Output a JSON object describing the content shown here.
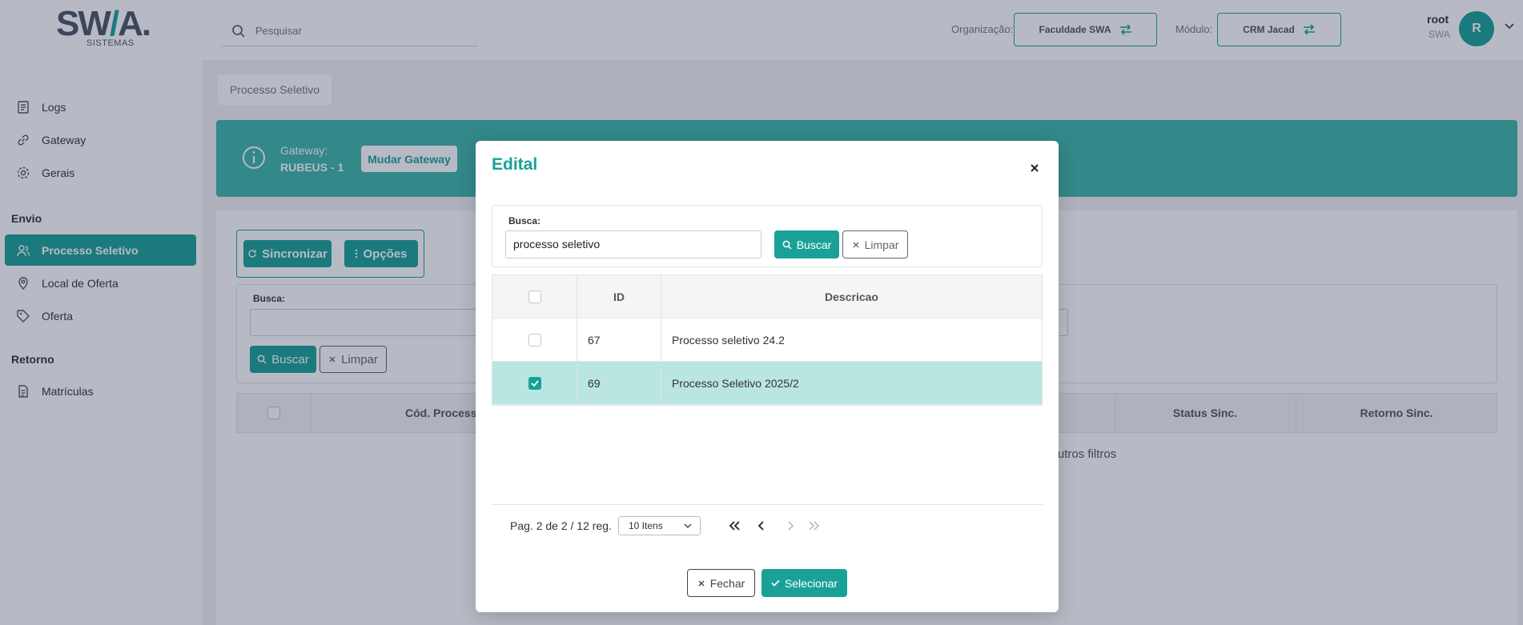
{
  "colors": {
    "accent": "#1aa197",
    "banner": "#3db5a9",
    "selected_row": "#b9e6e1"
  },
  "header": {
    "logo_text": "SWA.",
    "logo_sub": "SISTEMAS",
    "search_placeholder": "Pesquisar",
    "org_label": "Organização:",
    "org_value": "Faculdade SWA",
    "module_label": "Módulo:",
    "module_value": "CRM Jacad",
    "user_name": "root",
    "user_org": "SWA",
    "avatar_initial": "R"
  },
  "sidebar": {
    "items": [
      {
        "label": "Logs",
        "icon": "log-icon"
      },
      {
        "label": "Gateway",
        "icon": "link-icon"
      },
      {
        "label": "Gerais",
        "icon": "gear-icon"
      }
    ],
    "section_envio": "Envio",
    "envio_items": [
      {
        "label": "Processo Seletivo",
        "icon": "users-icon",
        "active": true
      },
      {
        "label": "Local de Oferta",
        "icon": "location-pin-icon"
      },
      {
        "label": "Oferta",
        "icon": "tag-icon"
      }
    ],
    "section_retorno": "Retorno",
    "retorno_items": [
      {
        "label": "Matrículas",
        "icon": "document-icon"
      }
    ]
  },
  "main": {
    "breadcrumb": "Processo Seletivo",
    "gateway_label": "Gateway:",
    "gateway_value": "RUBEUS - 1",
    "change_gateway": "Mudar Gateway",
    "sync_button": "Sincronizar",
    "options_button": "Opções",
    "search_label": "Busca:",
    "search_button": "Buscar",
    "clear_button": "Limpar",
    "columns": {
      "col2": "Cód. Processo",
      "col_status": "Status Sinc.",
      "col_retorno": "Retorno Sinc."
    },
    "empty_text": "ar outros filtros"
  },
  "modal": {
    "title": "Edital",
    "search_label": "Busca:",
    "search_value": "processo seletivo",
    "search_button": "Buscar",
    "clear_button": "Limpar",
    "columns": {
      "id": "ID",
      "description": "Descricao"
    },
    "rows": [
      {
        "id": "67",
        "description": "Processo seletivo 24.2",
        "checked": false
      },
      {
        "id": "69",
        "description": "Processo Seletivo 2025/2",
        "checked": true
      }
    ],
    "pagination_text": "Pag. 2 de 2 / 12 reg.",
    "page_size": "10 Itens",
    "close_button": "Fechar",
    "select_button": "Selecionar"
  }
}
